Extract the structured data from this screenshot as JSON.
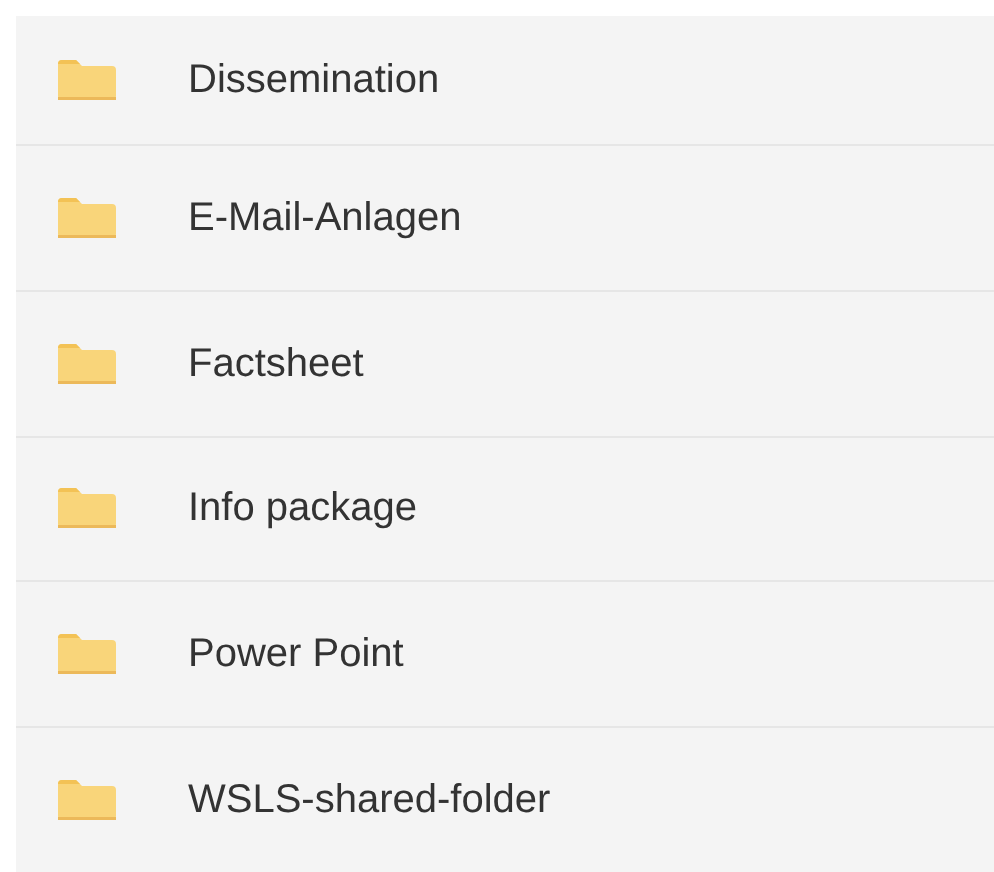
{
  "folders": [
    {
      "name": "Dissemination"
    },
    {
      "name": "E-Mail-Anlagen"
    },
    {
      "name": "Factsheet"
    },
    {
      "name": "Info package"
    },
    {
      "name": "Power Point"
    },
    {
      "name": "WSLS-shared-folder"
    }
  ]
}
